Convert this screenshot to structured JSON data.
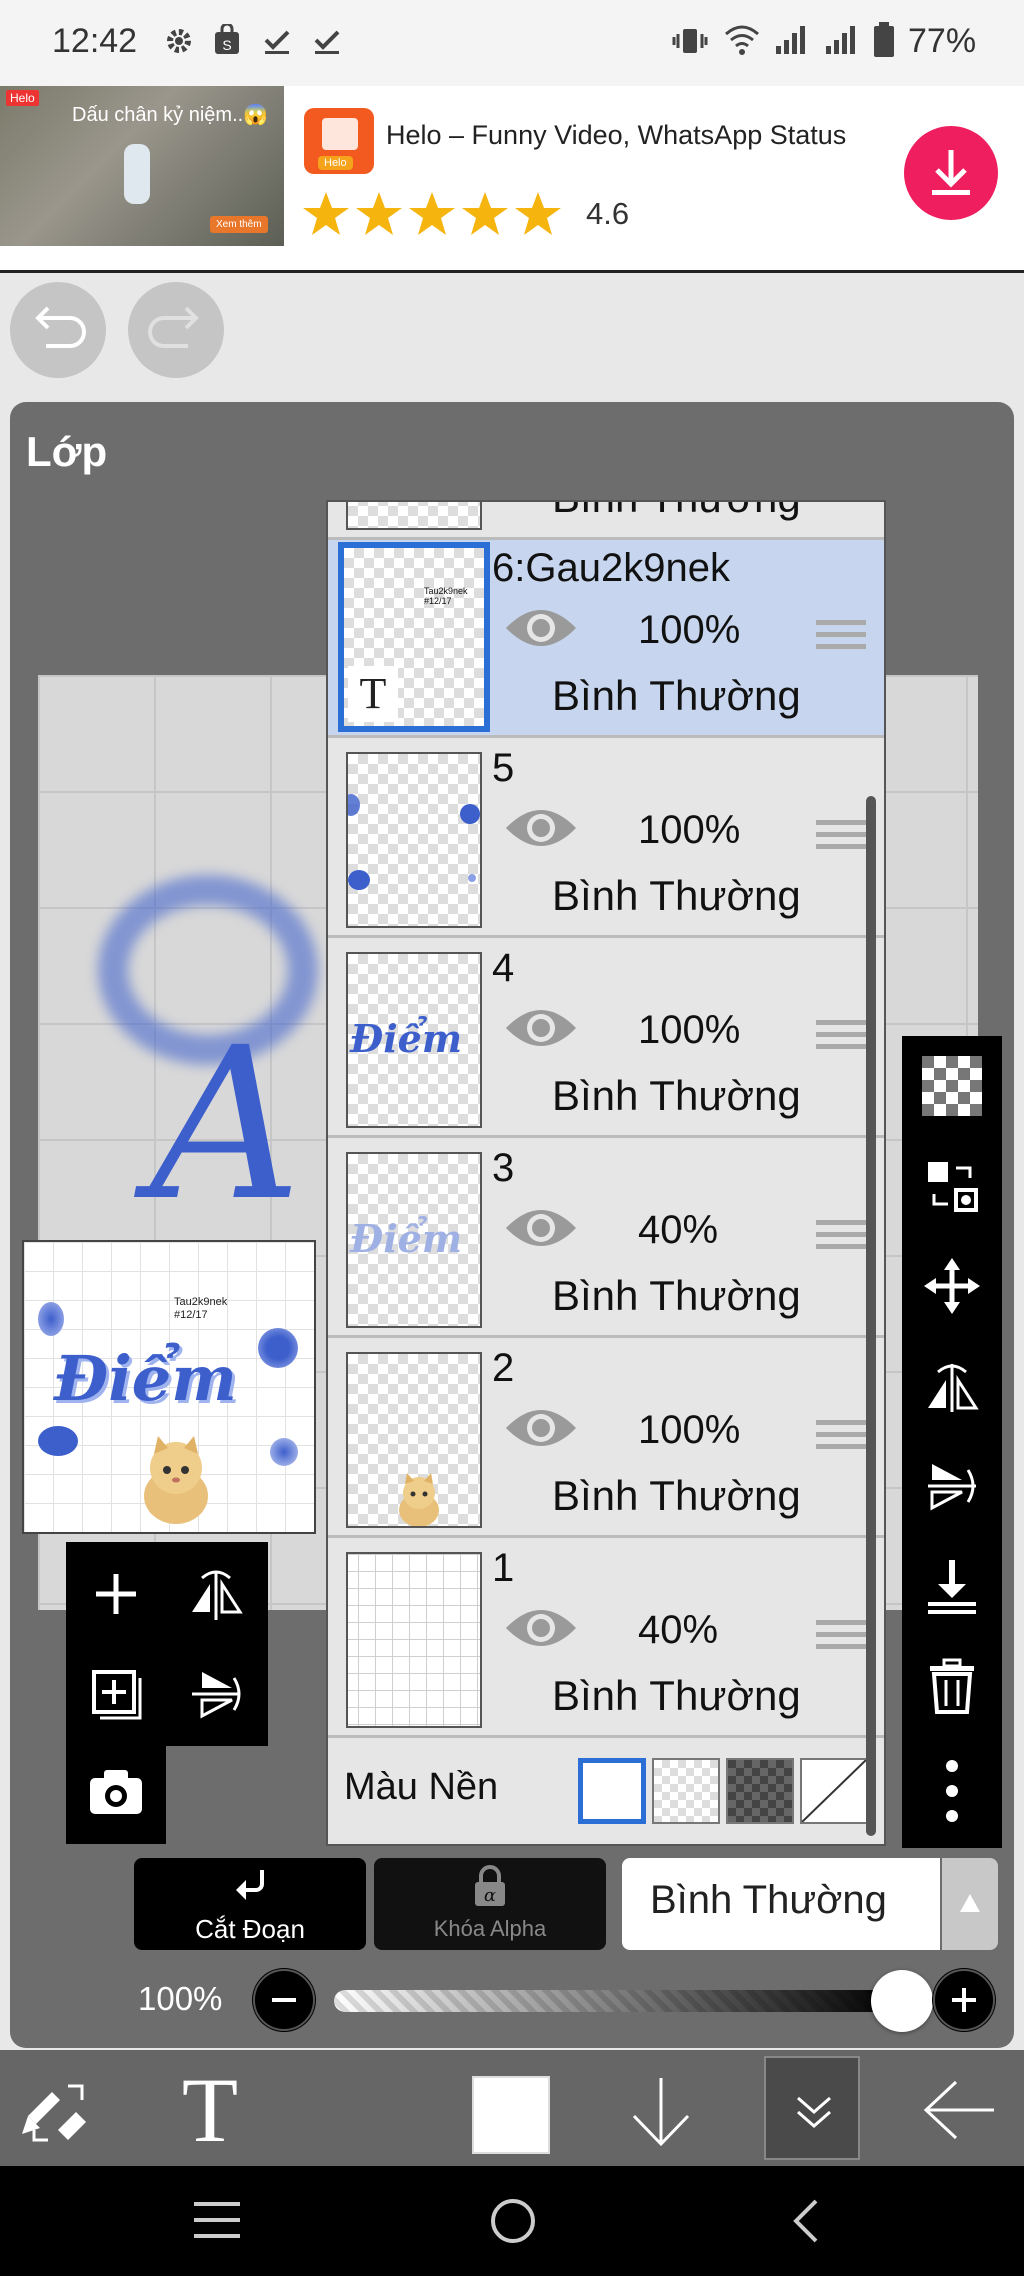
{
  "status_bar": {
    "time": "12:42",
    "battery": "77%"
  },
  "ad": {
    "thumb_tag": "Helo",
    "thumb_caption": "Dấu chân kỷ niệm..😱",
    "thumb_button": "Xem thêm",
    "logo_label": "Helo",
    "title": "Helo – Funny Video, WhatsApp Status",
    "rating": "4.6",
    "stars": 5
  },
  "panel": {
    "title": "Lớp",
    "partial_layer_mode": "Bình Thường",
    "layers": [
      {
        "name": "6:Gau2k9nek",
        "opacity": "100%",
        "mode": "Bình Thường",
        "selected": true,
        "text_layer": true,
        "thumb_text": "Tau2k9nek\n#12/17"
      },
      {
        "name": "5",
        "opacity": "100%",
        "mode": "Bình Thường",
        "selected": false
      },
      {
        "name": "4",
        "opacity": "100%",
        "mode": "Bình Thường",
        "selected": false,
        "thumb_text": "Điểm"
      },
      {
        "name": "3",
        "opacity": "40%",
        "mode": "Bình Thường",
        "selected": false,
        "thumb_text": "Điểm"
      },
      {
        "name": "2",
        "opacity": "100%",
        "mode": "Bình Thường",
        "selected": false
      },
      {
        "name": "1",
        "opacity": "40%",
        "mode": "Bình Thường",
        "selected": false
      }
    ],
    "background_label": "Màu Nền",
    "preview_text": "Điểm",
    "preview_small_text": "Tau2k9nek\n#12/17"
  },
  "controls": {
    "clipping_label": "Cắt Đoạn",
    "alpha_lock_label": "Khóa Alpha",
    "blend_mode": "Bình Thường",
    "opacity_label": "100%",
    "opacity_value": 1.0
  },
  "colors": {
    "selected_border": "#2a6ed6",
    "art_blue": "#3d5fcc",
    "ad_pink": "#ef1e5f"
  }
}
